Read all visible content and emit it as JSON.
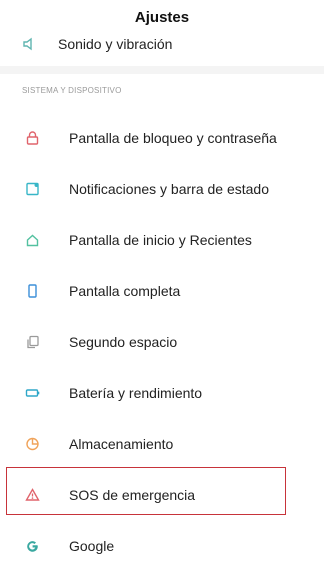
{
  "header": {
    "title": "Ajustes"
  },
  "partial_item": {
    "label": "Sonido y vibración",
    "icon": "speaker-icon"
  },
  "section": {
    "title": "SISTEMA Y DISPOSITIVO"
  },
  "items": [
    {
      "label": "Pantalla de bloqueo y contraseña",
      "icon": "lock-icon",
      "color": "#e0646c"
    },
    {
      "label": "Notificaciones y barra de estado",
      "icon": "notification-icon",
      "color": "#38b6c7"
    },
    {
      "label": "Pantalla de inicio y Recientes",
      "icon": "home-icon",
      "color": "#53c1a0"
    },
    {
      "label": "Pantalla completa",
      "icon": "phone-icon",
      "color": "#3b8fd9"
    },
    {
      "label": "Segundo espacio",
      "icon": "second-space-icon",
      "color": "#9a9a9a"
    },
    {
      "label": "Batería y rendimiento",
      "icon": "battery-icon",
      "color": "#2fa7c9"
    },
    {
      "label": "Almacenamiento",
      "icon": "storage-icon",
      "color": "#f0a35a"
    },
    {
      "label": "SOS de emergencia",
      "icon": "sos-icon",
      "color": "#e0646c",
      "highlighted": true
    },
    {
      "label": "Google",
      "icon": "google-icon",
      "color": "#3aa8a0"
    }
  ]
}
